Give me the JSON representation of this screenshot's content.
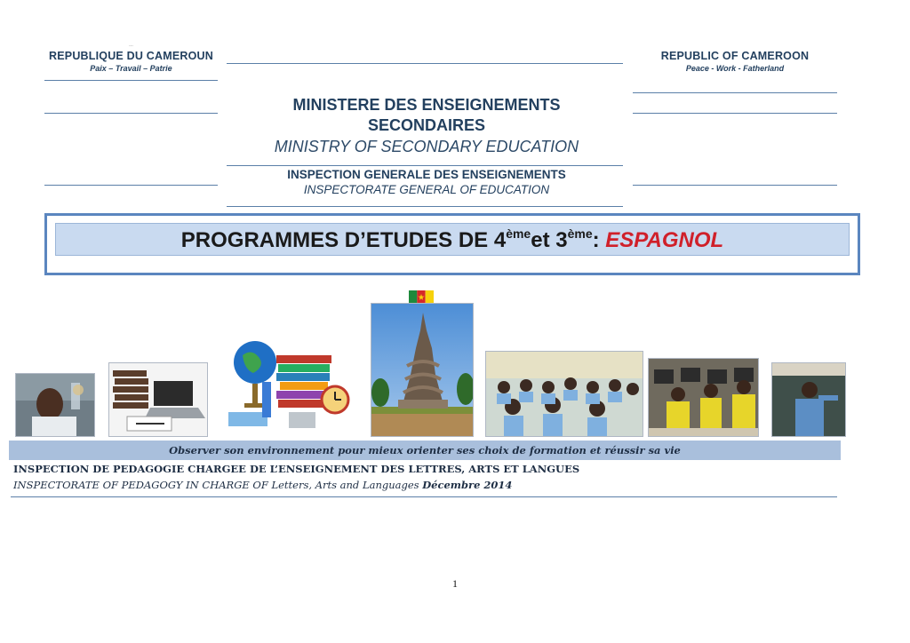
{
  "header": {
    "left": {
      "small_mark": "…",
      "country": "REPUBLIQUE DU CAMEROUN",
      "motto": "Paix – Travail – Patrie"
    },
    "right": {
      "country": "REPUBLIC OF CAMEROON",
      "motto": "Peace - Work - Fatherland"
    },
    "ministry_fr_line1": "MINISTERE DES ENSEIGNEMENTS",
    "ministry_fr_line2": "SECONDAIRES",
    "ministry_en": "MINISTRY OF SECONDARY EDUCATION",
    "inspection_fr": "INSPECTION GENERALE DES ENSEIGNEMENTS",
    "inspection_en": "INSPECTORATE GENERAL OF EDUCATION"
  },
  "title": {
    "prefix": "PROGRAMMES D’ETUDES DE 4",
    "sup1": "ème",
    "middle": "et 3",
    "sup2": "ème",
    "colon": ": ",
    "subject": "ESPAGNOL",
    "subject_color": "#d0202a"
  },
  "images": [
    {
      "name": "scientist-photo",
      "description_icon": "photo-icon"
    },
    {
      "name": "books-laptop-photo",
      "description_icon": "photo-icon"
    },
    {
      "name": "globe-books-clock-illustration",
      "description_icon": "photo-icon"
    },
    {
      "name": "reunification-monument-photo",
      "description_icon": "photo-icon"
    },
    {
      "name": "classroom-photo",
      "description_icon": "photo-icon"
    },
    {
      "name": "computer-lab-photo",
      "description_icon": "photo-icon"
    },
    {
      "name": "teacher-blackboard-photo",
      "description_icon": "photo-icon"
    }
  ],
  "banner": "Observer son environnement  pour mieux orienter ses choix de formation et réussir sa vie",
  "pedagogy": {
    "fr": "INSPECTION DE PEDAGOGIE CHARGEE DE L’ENSEIGNEMENT DES LETTRES, ARTS ET LANGUES",
    "en_main": "INSPECTORATE OF PEDAGOGY IN CHARGE OF Letters, Arts and Languages ",
    "en_date": "Décembre 2014"
  },
  "page_number": "1",
  "colors": {
    "rule": "#5b7fa8",
    "banner": "#a9bfdc",
    "title_band": "#c9daf0"
  }
}
